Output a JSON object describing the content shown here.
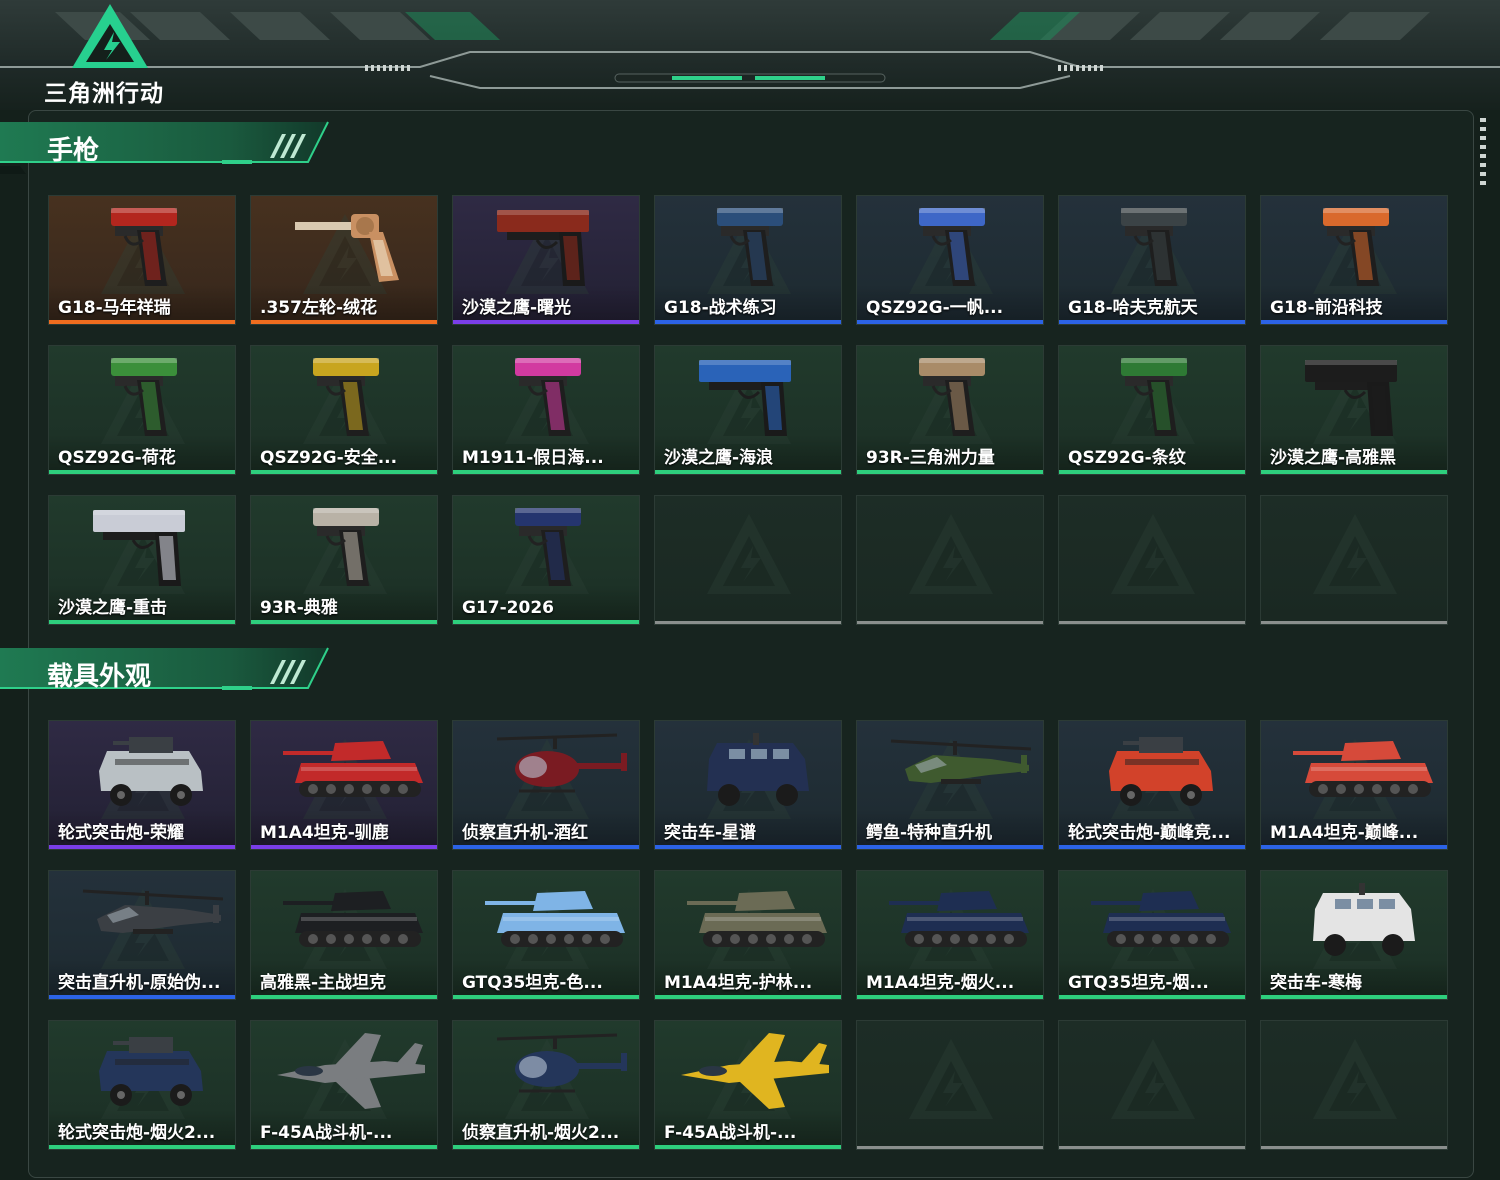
{
  "app": {
    "logo_text": "三角洲行动"
  },
  "sections": [
    {
      "title": "手枪",
      "items": [
        {
          "name": "G18-马年祥瑞",
          "rarity": "orange",
          "kind": "pistol",
          "tint": "#b3261e"
        },
        {
          "name": ".357左轮-绒花",
          "rarity": "orange",
          "kind": "revolver",
          "tint": "#c99062"
        },
        {
          "name": "沙漠之鹰-曙光",
          "rarity": "purple",
          "kind": "deagle",
          "tint": "#8a2a1c"
        },
        {
          "name": "G18-战术练习",
          "rarity": "blue",
          "kind": "pistol",
          "tint": "#2b4e7a"
        },
        {
          "name": "QSZ92G-一帆...",
          "rarity": "blue",
          "kind": "pistol",
          "tint": "#3e67c7"
        },
        {
          "name": "G18-哈夫克航天",
          "rarity": "blue",
          "kind": "pistol",
          "tint": "#3b4346"
        },
        {
          "name": "G18-前沿科技",
          "rarity": "blue",
          "kind": "pistol",
          "tint": "#d9692c"
        },
        {
          "name": "QSZ92G-荷花",
          "rarity": "green",
          "kind": "pistol",
          "tint": "#3b8f3a"
        },
        {
          "name": "QSZ92G-安全...",
          "rarity": "green",
          "kind": "pistol",
          "tint": "#c8a51f"
        },
        {
          "name": "M1911-假日海...",
          "rarity": "green",
          "kind": "pistol",
          "tint": "#d23aa0"
        },
        {
          "name": "沙漠之鹰-海浪",
          "rarity": "green",
          "kind": "deagle",
          "tint": "#2a63b8"
        },
        {
          "name": "93R-三角洲力量",
          "rarity": "green",
          "kind": "pistol",
          "tint": "#a98b68"
        },
        {
          "name": "QSZ92G-条纹",
          "rarity": "green",
          "kind": "pistol",
          "tint": "#2e7a34"
        },
        {
          "name": "沙漠之鹰-高雅黑",
          "rarity": "green",
          "kind": "deagle",
          "tint": "#1c1c1c"
        },
        {
          "name": "沙漠之鹰-重击",
          "rarity": "green",
          "kind": "deagle",
          "tint": "#c9ccd6"
        },
        {
          "name": "93R-典雅",
          "rarity": "green",
          "kind": "pistol",
          "tint": "#b9b2a6"
        },
        {
          "name": "G17-2026",
          "rarity": "green",
          "kind": "pistol",
          "tint": "#25356e"
        },
        {
          "name": "",
          "rarity": "empty"
        },
        {
          "name": "",
          "rarity": "empty"
        },
        {
          "name": "",
          "rarity": "empty"
        },
        {
          "name": "",
          "rarity": "empty"
        }
      ]
    },
    {
      "title": "载具外观",
      "items": [
        {
          "name": "轮式突击炮-荣耀",
          "rarity": "purple",
          "kind": "wheeled",
          "tint": "#b9c0c4"
        },
        {
          "name": "M1A4坦克-驯鹿",
          "rarity": "purple",
          "kind": "tank",
          "tint": "#c22a2a"
        },
        {
          "name": "侦察直升机-酒红",
          "rarity": "blue",
          "kind": "heli",
          "tint": "#7a1b22"
        },
        {
          "name": "突击车-星谱",
          "rarity": "blue",
          "kind": "truck",
          "tint": "#233052"
        },
        {
          "name": "鳄鱼-特种直升机",
          "rarity": "blue",
          "kind": "attackheli",
          "tint": "#3f5a2f"
        },
        {
          "name": "轮式突击炮-巅峰竞...",
          "rarity": "blue",
          "kind": "wheeled",
          "tint": "#d2422a"
        },
        {
          "name": "M1A4坦克-巅峰...",
          "rarity": "blue",
          "kind": "tank",
          "tint": "#d64a3a"
        },
        {
          "name": "突击直升机-原始伪...",
          "rarity": "blue",
          "kind": "attackheli",
          "tint": "#3b3f44"
        },
        {
          "name": "高雅黑-主战坦克",
          "rarity": "green",
          "kind": "tank",
          "tint": "#1d1f22"
        },
        {
          "name": "GTQ35坦克-色...",
          "rarity": "green",
          "kind": "tank",
          "tint": "#7fb4e6"
        },
        {
          "name": "M1A4坦克-护林...",
          "rarity": "green",
          "kind": "tank",
          "tint": "#6b6b55"
        },
        {
          "name": "M1A4坦克-烟火...",
          "rarity": "green",
          "kind": "tank",
          "tint": "#1e2e52"
        },
        {
          "name": "GTQ35坦克-烟...",
          "rarity": "green",
          "kind": "tank",
          "tint": "#1e2e52"
        },
        {
          "name": "突击车-寒梅",
          "rarity": "green",
          "kind": "truck",
          "tint": "#e4e4e4"
        },
        {
          "name": "轮式突击炮-烟火2...",
          "rarity": "green",
          "kind": "wheeled",
          "tint": "#24365a"
        },
        {
          "name": "F-45A战斗机-...",
          "rarity": "green",
          "kind": "jet",
          "tint": "#7a7d80"
        },
        {
          "name": "侦察直升机-烟火2...",
          "rarity": "green",
          "kind": "heli",
          "tint": "#24365a"
        },
        {
          "name": "F-45A战斗机-...",
          "rarity": "green",
          "kind": "jet",
          "tint": "#e0b520"
        },
        {
          "name": "",
          "rarity": "empty"
        },
        {
          "name": "",
          "rarity": "empty"
        },
        {
          "name": "",
          "rarity": "empty"
        }
      ]
    }
  ]
}
